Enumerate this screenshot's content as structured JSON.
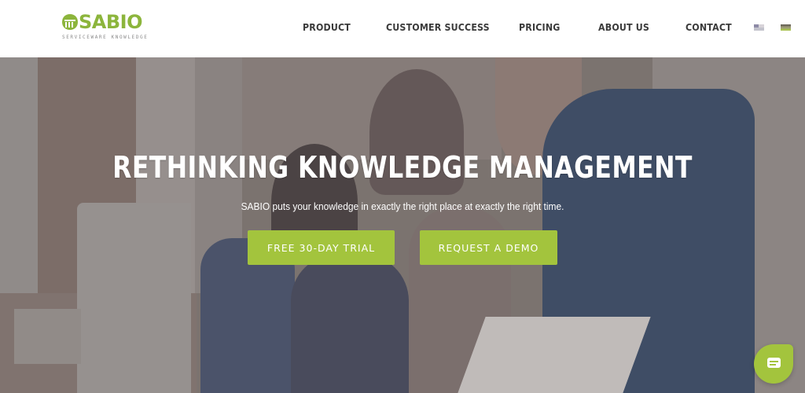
{
  "brand": {
    "name": "SABIO",
    "tagline": "SERVICEWARE KNOWLEDGE",
    "logo_icon": "columns-leaf-icon",
    "accent_color": "#8cb53c"
  },
  "nav": {
    "items": [
      {
        "label": "PRODUCT"
      },
      {
        "label": "CUSTOMER SUCCESS"
      },
      {
        "label": "PRICING"
      },
      {
        "label": "ABOUT US"
      },
      {
        "label": "CONTACT"
      }
    ],
    "languages": [
      {
        "icon": "flag-english-icon"
      },
      {
        "icon": "flag-german-icon"
      }
    ]
  },
  "hero": {
    "title": "RETHINKING KNOWLEDGE MANAGEMENT",
    "subtitle": "SABIO puts your knowledge in exactly the right place at exactly the right time.",
    "buttons": [
      {
        "label": "FREE 30-DAY TRIAL"
      },
      {
        "label": "REQUEST A DEMO"
      }
    ],
    "button_color": "#a3c43d"
  },
  "chat": {
    "icon": "chat-bubble-icon"
  }
}
